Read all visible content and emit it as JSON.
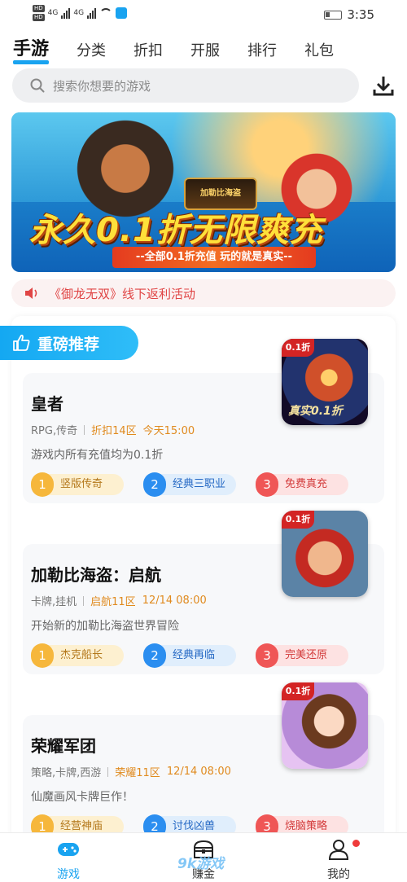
{
  "status_bar": {
    "time": "3:35",
    "hd1": "HD",
    "hd2": "HD",
    "net1": "4G",
    "net2": "4G"
  },
  "tabs": [
    {
      "label": "手游",
      "active": true
    },
    {
      "label": "分类"
    },
    {
      "label": "折扣"
    },
    {
      "label": "开服"
    },
    {
      "label": "排行"
    },
    {
      "label": "礼包"
    }
  ],
  "search": {
    "placeholder": "搜索你想要的游戏"
  },
  "banner": {
    "logo_text": "加勒比海盗",
    "headline": "永久0.1折无限爽充",
    "ribbon": "--全部0.1折充值 玩的就是真实--"
  },
  "notice": {
    "text": "《御龙无双》线下返利活动"
  },
  "section": {
    "title": "重磅推荐"
  },
  "games": [
    {
      "name": "皇者",
      "genre": "RPG,传奇",
      "server": "折扣14区",
      "time": "今天15:00",
      "desc": "游戏内所有充值均为0.1折",
      "badge": "0.1折",
      "thumb_caption": "真实0.1折",
      "tags": [
        "竖版传奇",
        "经典三职业",
        "免费真充"
      ]
    },
    {
      "name": "加勒比海盗：启航",
      "genre": "卡牌,挂机",
      "server": "启航11区",
      "time": "12/14 08:00",
      "desc": "开始新的加勒比海盗世界冒险",
      "badge": "0.1折",
      "tags": [
        "杰克船长",
        "经典再临",
        "完美还原"
      ]
    },
    {
      "name": "荣耀军团",
      "genre": "策略,卡牌,西游",
      "server": "荣耀11区",
      "time": "12/14 08:00",
      "desc": "仙魔画风卡牌巨作！",
      "badge": "0.1折",
      "tags": [
        "经营神庙",
        "讨伐凶兽",
        "烧脑策略"
      ]
    }
  ],
  "bottom_nav": [
    {
      "label": "游戏",
      "active": true
    },
    {
      "label": "赚金"
    },
    {
      "label": "我的"
    }
  ],
  "watermark": "9k游戏",
  "colors": {
    "accent": "#19a3f0",
    "notice": "#e04545",
    "server": "#e08a1e"
  }
}
